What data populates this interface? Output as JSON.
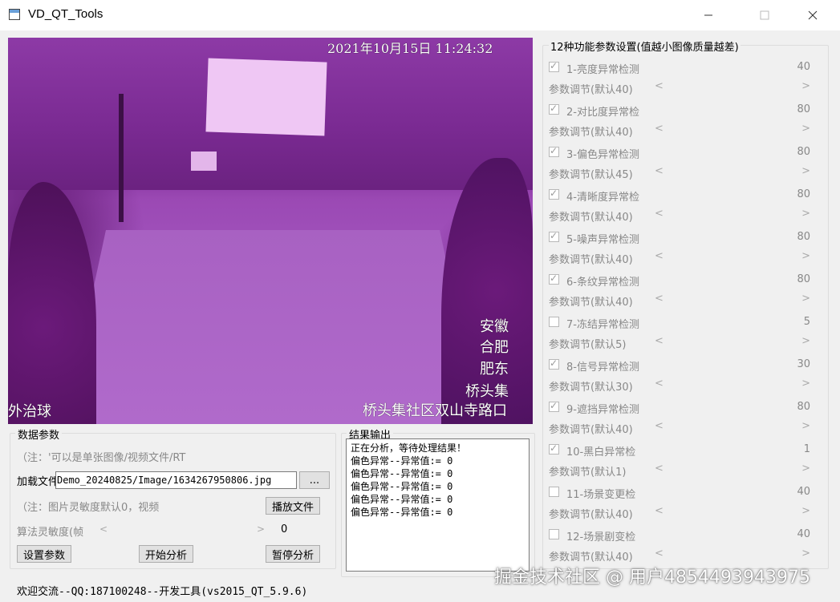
{
  "window": {
    "title": "VD_QT_Tools"
  },
  "video": {
    "timestamp": "2021年10月15日  11:24:32",
    "osd_right": [
      "安徽",
      "合肥",
      "肥东",
      "桥头集"
    ],
    "osd_bottom_left": "外治球",
    "osd_bottom_right": "桥头集社区双山寺路口"
  },
  "data_params": {
    "title": "数据参数",
    "note1": "（注：'可以是单张图像/视频文件/RT",
    "load_label": "加载文件",
    "file_path": "Demo_20240825/Image/1634267950806.jpg",
    "browse_label": "...",
    "note2": "（注：图片灵敏度默认0，视频",
    "play_label": "播放文件",
    "sensitivity_label": "算法灵敏度(帧",
    "sensitivity_value": "0",
    "set_params_label": "设置参数",
    "start_label": "开始分析",
    "pause_label": "暂停分析"
  },
  "result": {
    "title": "结果输出",
    "lines": [
      "正在分析，等待处理结果！",
      "偏色异常--异常值:= 0",
      "偏色异常--异常值:= 0",
      "偏色异常--异常值:= 0",
      "偏色异常--异常值:= 0",
      "偏色异常--异常值:= 0"
    ]
  },
  "params": {
    "title": "12种功能参数设置(值越小图像质量越差)",
    "items": [
      {
        "label": "1-亮度异常检测",
        "checked": true,
        "value": "40",
        "adjust": "参数调节(默认40)"
      },
      {
        "label": "2-对比度异常检",
        "checked": true,
        "value": "80",
        "adjust": "参数调节(默认40)"
      },
      {
        "label": "3-偏色异常检测",
        "checked": true,
        "value": "80",
        "adjust": "参数调节(默认45)"
      },
      {
        "label": "4-清晰度异常检",
        "checked": true,
        "value": "80",
        "adjust": "参数调节(默认40)"
      },
      {
        "label": "5-噪声异常检测",
        "checked": true,
        "value": "80",
        "adjust": "参数调节(默认40)"
      },
      {
        "label": "6-条纹异常检测",
        "checked": true,
        "value": "80",
        "adjust": "参数调节(默认40)"
      },
      {
        "label": "7-冻结异常检测",
        "checked": false,
        "value": "5",
        "adjust": "参数调节(默认5)"
      },
      {
        "label": "8-信号异常检测",
        "checked": true,
        "value": "30",
        "adjust": "参数调节(默认30)"
      },
      {
        "label": "9-遮挡异常检测",
        "checked": true,
        "value": "80",
        "adjust": "参数调节(默认40)"
      },
      {
        "label": "10-黑白异常检",
        "checked": true,
        "value": "1",
        "adjust": "参数调节(默认1)"
      },
      {
        "label": "11-场景变更检",
        "checked": false,
        "value": "40",
        "adjust": "参数调节(默认40)"
      },
      {
        "label": "12-场景剧变检",
        "checked": false,
        "value": "40",
        "adjust": "参数调节(默认40)"
      }
    ]
  },
  "footer": "欢迎交流--QQ:187100248--开发工具(vs2015_QT_5.9.6)",
  "watermark": "掘金技术社区 @ 用户4854493943975"
}
